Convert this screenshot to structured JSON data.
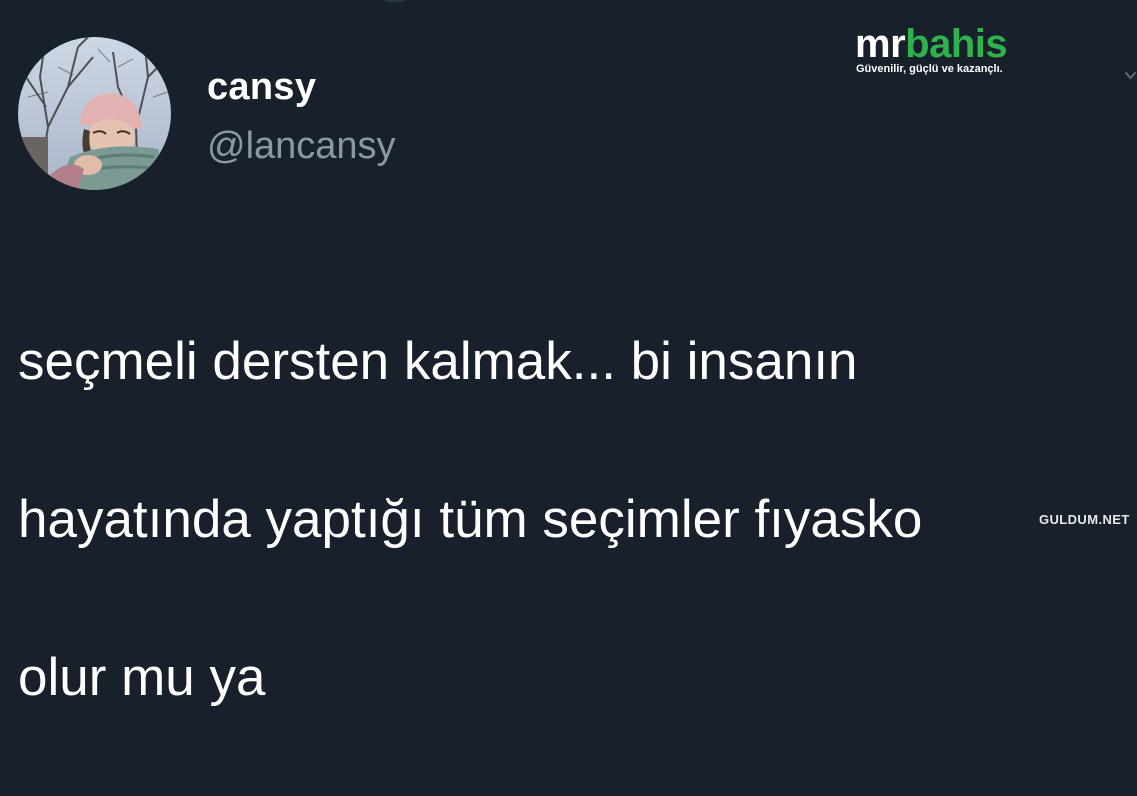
{
  "tweet": {
    "display_name": "cansy",
    "handle": "@lancansy",
    "text_lines": [
      "seçmeli dersten kalmak... bi insanın",
      "hayatında yaptığı tüm seçimler fıyasko",
      "olur mu ya"
    ]
  },
  "overlay": {
    "logo_part_1": "mr",
    "logo_part_2": "bahis",
    "logo_tagline": "Güvenilir, güçlü ve kazançlı.",
    "watermark": "GULDUM.NET"
  },
  "icons": {
    "more_menu": "chevron-down-icon"
  },
  "colors": {
    "background": "#17202b",
    "name": "#ffffff",
    "handle": "#8899a6",
    "body_text": "#ffffff",
    "logo_green": "#2fb24c"
  }
}
